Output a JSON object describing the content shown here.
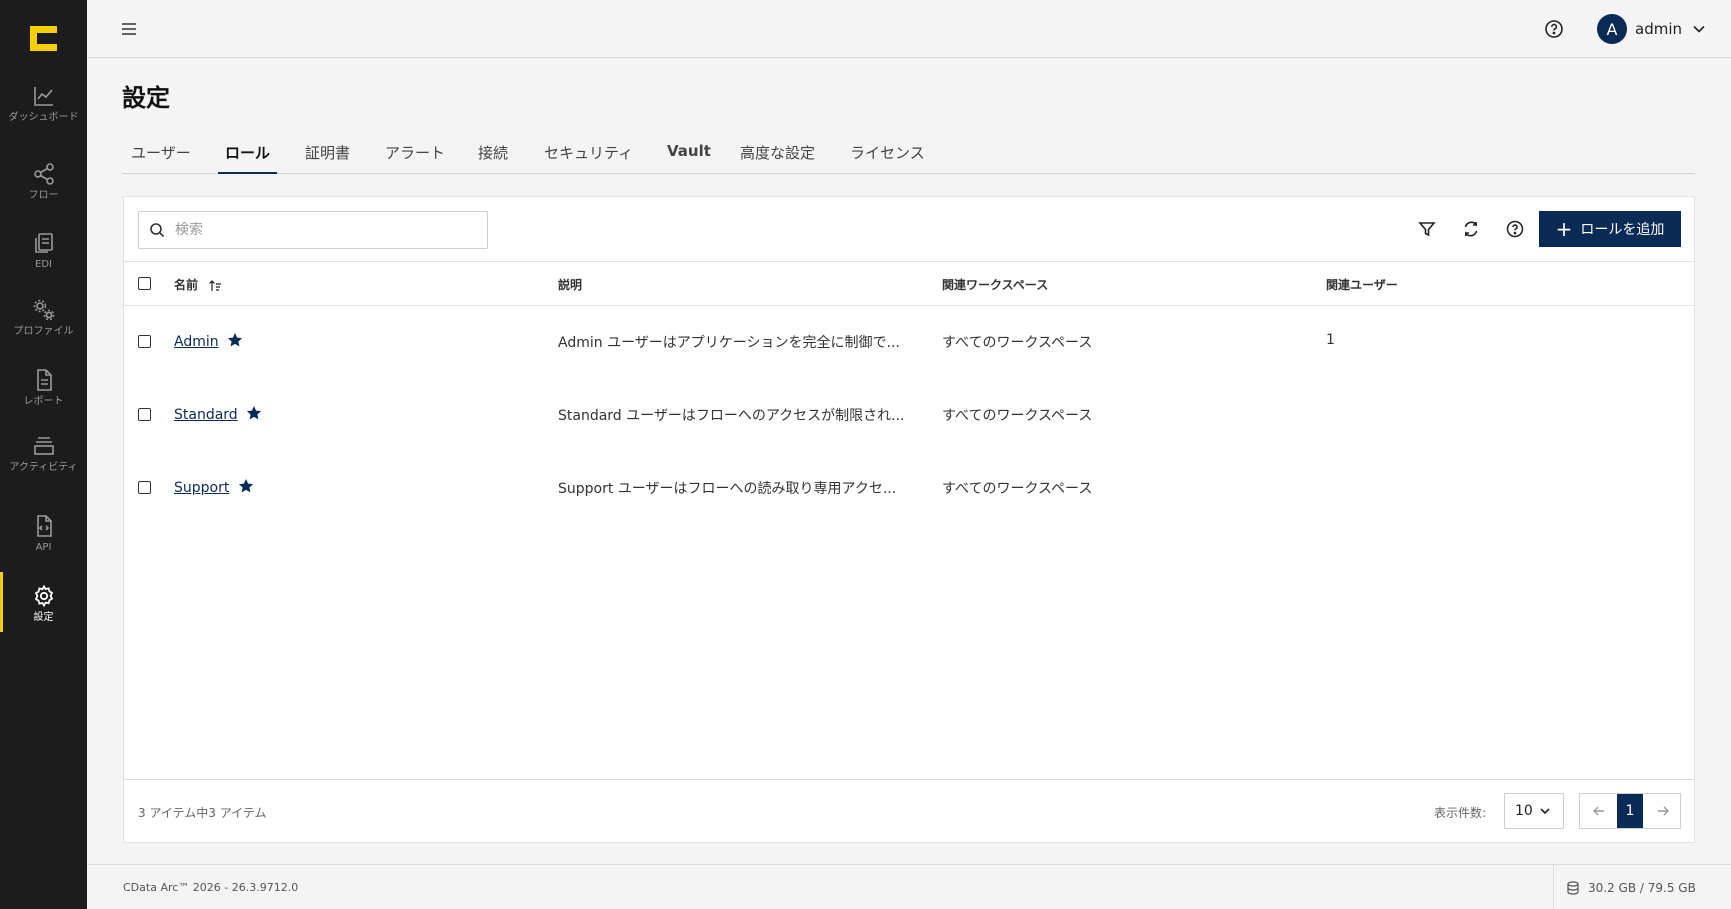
{
  "sidebar": {
    "items": [
      {
        "label": "ダッシュボード",
        "icon": "chart-line-icon"
      },
      {
        "label": "フロー",
        "icon": "share-nodes-icon"
      },
      {
        "label": "EDI",
        "icon": "documents-icon"
      },
      {
        "label": "プロファイル",
        "icon": "gears-icon"
      },
      {
        "label": "レポート",
        "icon": "report-icon"
      },
      {
        "label": "アクティビティ",
        "icon": "activity-stack-icon"
      },
      {
        "label": "API",
        "icon": "api-file-icon"
      },
      {
        "label": "設定",
        "icon": "gear-icon"
      }
    ],
    "active": "設定",
    "accent_color": "#f5d000"
  },
  "header": {
    "user_initial": "A",
    "user_name": "admin"
  },
  "page": {
    "title": "設定"
  },
  "tabs": [
    {
      "label": "ユーザー"
    },
    {
      "label": "ロール"
    },
    {
      "label": "証明書"
    },
    {
      "label": "アラート"
    },
    {
      "label": "接続"
    },
    {
      "label": "セキュリティ"
    },
    {
      "label": "Vault"
    },
    {
      "label": "高度な設定"
    },
    {
      "label": "ライセンス"
    }
  ],
  "active_tab": "ロール",
  "toolbar": {
    "search_placeholder": "検索",
    "add_label": "ロールを追加"
  },
  "table": {
    "columns": [
      "名前",
      "説明",
      "関連ワークスペース",
      "関連ユーザー"
    ],
    "rows": [
      {
        "name": "Admin",
        "description": "Admin ユーザーはアプリケーションを完全に制御で...",
        "workspace": "すべてのワークスペース",
        "users": "1"
      },
      {
        "name": "Standard",
        "description": "Standard ユーザーはフローへのアクセスが制限され...",
        "workspace": "すべてのワークスペース",
        "users": ""
      },
      {
        "name": "Support",
        "description": "Support ユーザーはフローへの読み取り専用アクセ...",
        "workspace": "すべてのワークスペース",
        "users": ""
      }
    ]
  },
  "pagination": {
    "summary": "3 アイテム中3 アイテム",
    "per_page_label": "表示件数:",
    "per_page_value": "10",
    "current_page": "1"
  },
  "footer": {
    "version": "CData Arc™ 2026 - 26.3.9712.0",
    "storage": "30.2 GB / 79.5 GB"
  },
  "colors": {
    "primary": "#0c2a56",
    "sidebar_bg": "#1c1c1c"
  }
}
